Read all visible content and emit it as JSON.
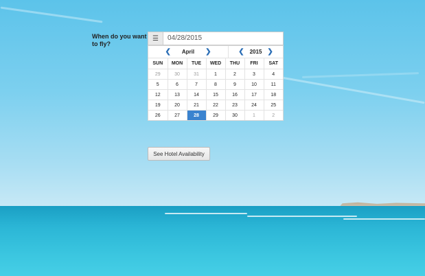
{
  "question": "When do you want to fly?",
  "date_field": {
    "value": "04/28/2015",
    "icon": "calendar-icon"
  },
  "calendar": {
    "month": "April",
    "year": "2015",
    "weekdays": [
      "SUN",
      "MON",
      "TUE",
      "WED",
      "THU",
      "FRI",
      "SAT"
    ],
    "weeks": [
      [
        "29",
        "30",
        "31",
        "1",
        "2",
        "3",
        "4"
      ],
      [
        "5",
        "6",
        "7",
        "8",
        "9",
        "10",
        "11"
      ],
      [
        "12",
        "13",
        "14",
        "15",
        "16",
        "17",
        "18"
      ],
      [
        "19",
        "20",
        "21",
        "22",
        "23",
        "24",
        "25"
      ],
      [
        "26",
        "27",
        "28",
        "29",
        "30",
        "1",
        "2"
      ]
    ],
    "selected": "28",
    "accent_color": "#3a83cf"
  },
  "hotel_button": "See Hotel Availability"
}
